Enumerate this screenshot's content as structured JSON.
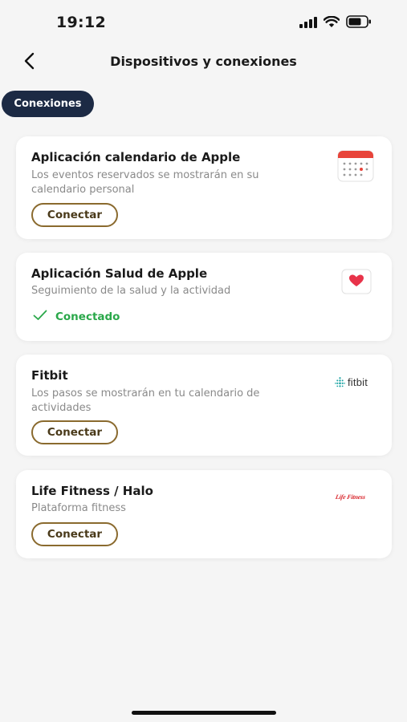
{
  "status": {
    "time": "19:12"
  },
  "nav": {
    "title": "Dispositivos y conexiones"
  },
  "tabs": [
    {
      "label": "Conexiones",
      "active": true
    }
  ],
  "cards": [
    {
      "title": "Aplicación calendario de Apple",
      "description": "Los eventos reservados se mostrarán en su calendario personal",
      "action_label": "Conectar",
      "icon": "calendar-icon"
    },
    {
      "title": "Aplicación Salud de Apple",
      "description": "Seguimiento de la salud y la actividad",
      "status_label": "Conectado",
      "icon": "heart-icon"
    },
    {
      "title": "Fitbit",
      "description": "Los pasos se mostrarán en tu calendario de actividades",
      "action_label": "Conectar",
      "icon": "fitbit-logo",
      "logo_text": "fitbit"
    },
    {
      "title": "Life Fitness / Halo",
      "description": "Plataforma fitness",
      "action_label": "Conectar",
      "icon": "life-fitness-logo",
      "logo_text": "Life Fitness"
    }
  ],
  "colors": {
    "tab_bg": "#1c2a44",
    "button_border": "#8a6a2e",
    "connected": "#2aa84a",
    "calendar_red": "#e8443a",
    "heart": "#e8334a",
    "fitbit_teal": "#1aa3a3",
    "life_fitness_red": "#d9262c"
  }
}
